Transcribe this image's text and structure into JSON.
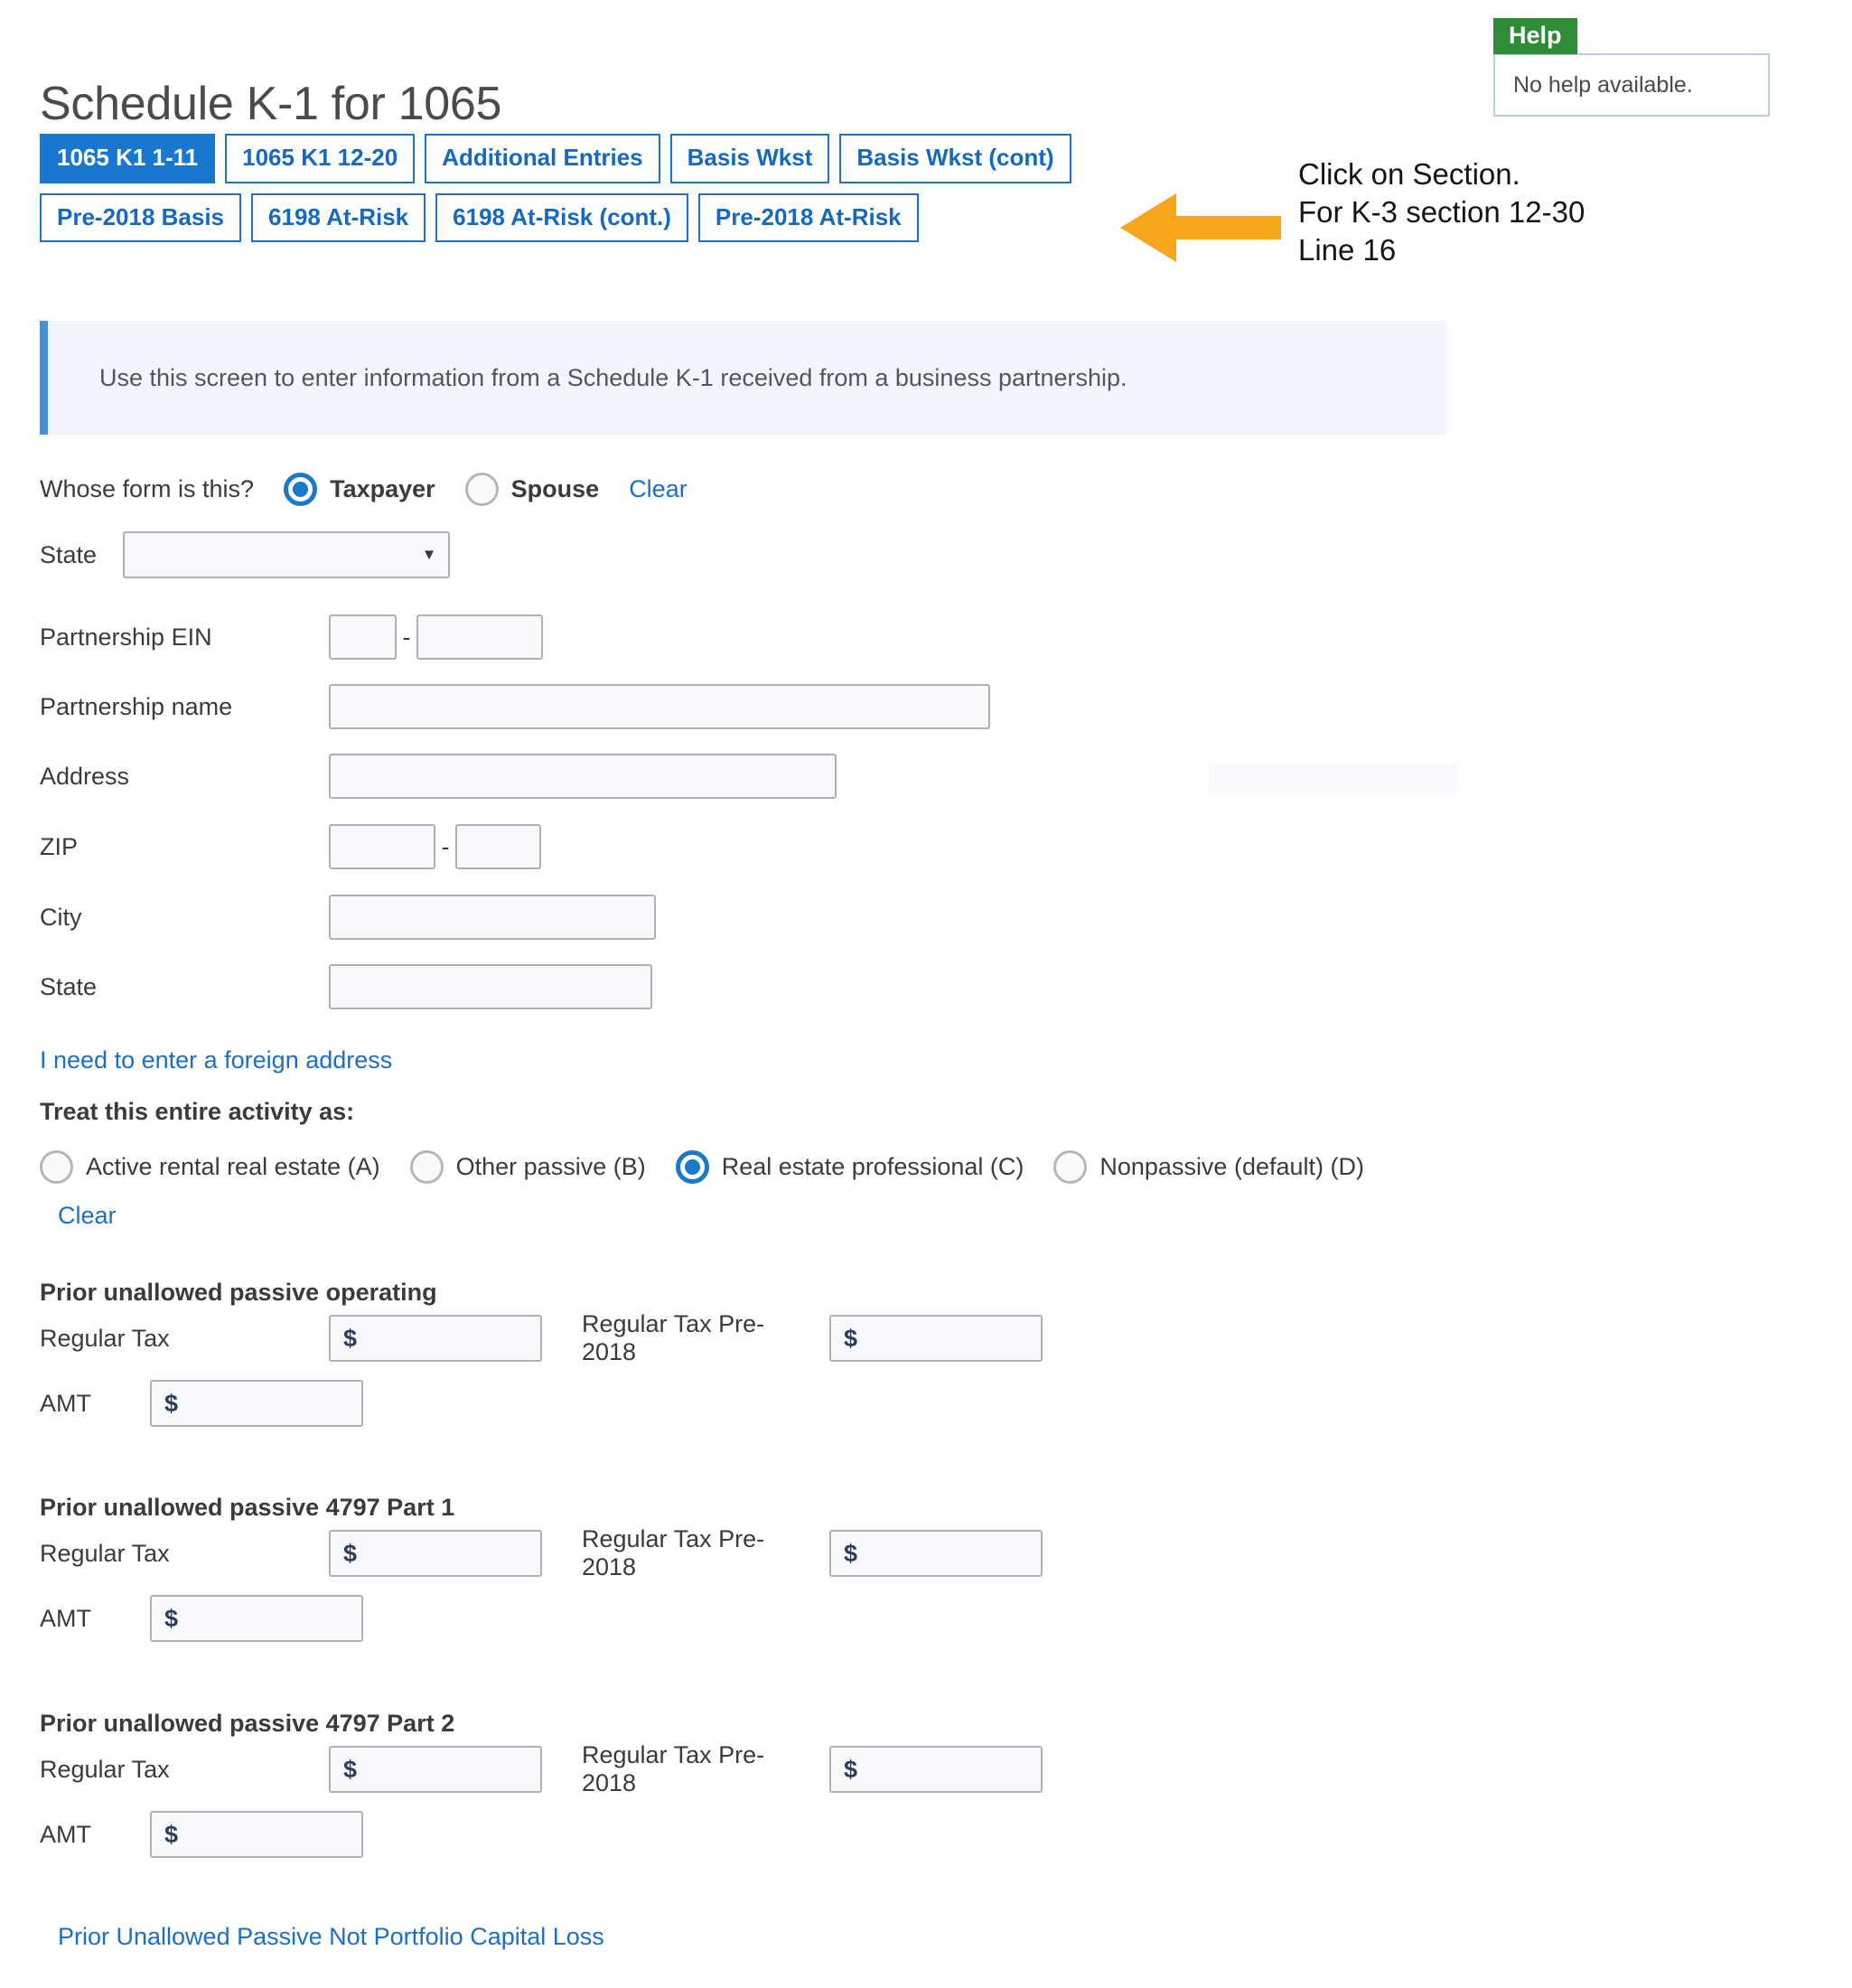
{
  "help": {
    "tab_label": "Help",
    "body_text": "No help available."
  },
  "page_title": "Schedule K-1 for 1065",
  "tabs": {
    "row1": [
      {
        "label": "1065 K1 1-11",
        "active": true
      },
      {
        "label": "1065 K1 12-20",
        "active": false
      },
      {
        "label": "Additional Entries",
        "active": false
      },
      {
        "label": "Basis Wkst",
        "active": false
      },
      {
        "label": "Basis Wkst (cont)",
        "active": false
      }
    ],
    "row2": [
      {
        "label": "Pre-2018 Basis",
        "active": false
      },
      {
        "label": "6198 At-Risk",
        "active": false
      },
      {
        "label": "6198 At-Risk (cont.)",
        "active": false
      },
      {
        "label": "Pre-2018 At-Risk",
        "active": false
      }
    ]
  },
  "annotation": {
    "arrow_color": "#F7A51C",
    "text": "Click on Section.\nFor K-3 section 12-30\nLine 16"
  },
  "info_banner": {
    "text": "Use this screen to enter information from a Schedule K-1 received from a business partnership.",
    "accent_color": "#4a8fd4",
    "background_color": "#f1f6fe"
  },
  "whose_form": {
    "question": "Whose form is this?",
    "options": [
      {
        "label": "Taxpayer",
        "selected": true
      },
      {
        "label": "Spouse",
        "selected": false
      }
    ],
    "clear_label": "Clear"
  },
  "state_select": {
    "label": "State",
    "value": "",
    "chevron": "chevron-down-icon"
  },
  "partnership": {
    "ein": {
      "label": "Partnership EIN",
      "part1": "",
      "part2": "",
      "separator": "-"
    },
    "name": {
      "label": "Partnership name",
      "value": ""
    },
    "address": {
      "label": "Address",
      "value": ""
    },
    "zip": {
      "label": "ZIP",
      "part1": "",
      "part2": "",
      "separator": "-"
    },
    "city": {
      "label": "City",
      "value": ""
    },
    "state": {
      "label": "State",
      "value": ""
    },
    "foreign_address_link": "I need to enter a foreign address"
  },
  "treat_activity": {
    "heading": "Treat this entire activity as:",
    "options": [
      {
        "label": "Active rental real estate (A)",
        "selected": false
      },
      {
        "label": "Other passive (B)",
        "selected": false
      },
      {
        "label": "Real estate professional (C)",
        "selected": true
      },
      {
        "label": "Nonpassive (default) (D)",
        "selected": false
      }
    ],
    "clear_label": "Clear"
  },
  "prior_sections": [
    {
      "heading": "Prior unallowed passive operating",
      "regular_tax_label": "Regular Tax",
      "regular_tax_value": "",
      "regular_tax_pre2018_label": "Regular Tax Pre-2018",
      "regular_tax_pre2018_value": "",
      "amt_label": "AMT",
      "amt_value": "",
      "currency_symbol": "$"
    },
    {
      "heading": "Prior unallowed passive 4797 Part 1",
      "regular_tax_label": "Regular Tax",
      "regular_tax_value": "",
      "regular_tax_pre2018_label": "Regular Tax Pre-2018",
      "regular_tax_pre2018_value": "",
      "amt_label": "AMT",
      "amt_value": "",
      "currency_symbol": "$"
    },
    {
      "heading": "Prior unallowed passive 4797 Part 2",
      "regular_tax_label": "Regular Tax",
      "regular_tax_value": "",
      "regular_tax_pre2018_label": "Regular Tax Pre-2018",
      "regular_tax_pre2018_value": "",
      "amt_label": "AMT",
      "amt_value": "",
      "currency_symbol": "$"
    }
  ],
  "bottom_link": "Prior Unallowed Passive Not Portfolio Capital Loss"
}
